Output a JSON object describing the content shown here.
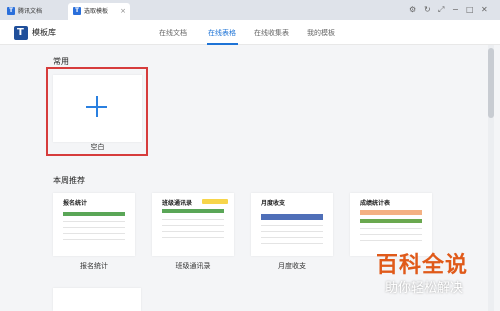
{
  "titlebar": {
    "tabs": [
      {
        "label": "腾讯文档"
      },
      {
        "label": "选取模板"
      }
    ],
    "close_tab_glyph": "×"
  },
  "header": {
    "brand": "模板库",
    "nav": [
      "在线文档",
      "在线表格",
      "在线收集表",
      "我的模板"
    ],
    "active_nav": "在线表格"
  },
  "sections": {
    "common": "常用",
    "weekly": "本周推荐"
  },
  "blank": {
    "label": "空白"
  },
  "templates": [
    {
      "title": "报名统计",
      "label": "报名统计"
    },
    {
      "title": "班级通讯录",
      "label": "班级通讯录"
    },
    {
      "title": "月度收支",
      "label": "月度收支"
    },
    {
      "title": "成绩统计表",
      "label": ""
    }
  ],
  "watermark": {
    "line1": "百科全说",
    "line2": "助你轻松解决"
  },
  "colors": {
    "accent": "#1d73d6",
    "highlight": "#d63c3c"
  }
}
